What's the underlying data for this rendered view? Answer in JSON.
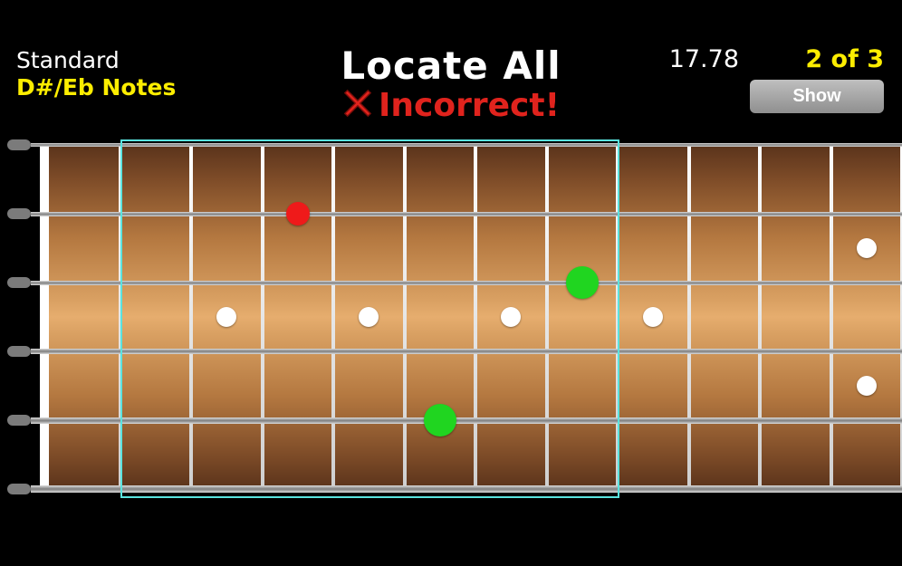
{
  "header": {
    "tuning": "Standard",
    "target": "D#/Eb Notes",
    "title": "Locate All",
    "feedback": "Incorrect!",
    "timer": "17.78",
    "counter": "2 of 3",
    "show_label": "Show"
  },
  "fretboard": {
    "strings": 6,
    "displayed_frets": 12,
    "string_thickness": [
      4,
      5,
      5,
      6,
      7,
      8
    ],
    "highlight": {
      "from_fret": 2,
      "to_fret": 8
    },
    "fret_markers": [
      {
        "fret": 3,
        "between_strings": 3.5
      },
      {
        "fret": 5,
        "between_strings": 3.5
      },
      {
        "fret": 7,
        "between_strings": 3.5
      },
      {
        "fret": 9,
        "between_strings": 3.5
      },
      {
        "fret": 12,
        "between_strings": 2.5
      },
      {
        "fret": 12,
        "between_strings": 4.5
      }
    ],
    "answers": [
      {
        "string": 2,
        "fret": 4,
        "state": "wrong"
      },
      {
        "string": 3,
        "fret": 8,
        "state": "correct"
      },
      {
        "string": 5,
        "fret": 6,
        "state": "correct"
      }
    ]
  },
  "colors": {
    "accent_yellow": "#fced00",
    "error_red": "#e0231d",
    "correct_green": "#20d520",
    "highlight_cyan": "#5ae3df"
  }
}
